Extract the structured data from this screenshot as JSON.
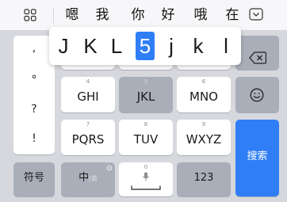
{
  "candidate_bar": {
    "candidates": [
      "嗯",
      "我",
      "你",
      "好",
      "哦",
      "在"
    ]
  },
  "popup": {
    "letters": [
      "J",
      "K",
      "L",
      "5",
      "j",
      "k",
      "l"
    ],
    "selected": "5"
  },
  "left_column": {
    "items": [
      ",",
      "°",
      "?",
      "!"
    ]
  },
  "keys": {
    "ghi": {
      "num": "4",
      "label": "GHI"
    },
    "jkl": {
      "num": "5",
      "label": "JKL"
    },
    "mno": {
      "num": "6",
      "label": "MNO"
    },
    "pqrs": {
      "num": "7",
      "label": "PQRS"
    },
    "tuv": {
      "num": "8",
      "label": "TUV"
    },
    "wxyz": {
      "num": "9",
      "label": "WXYZ"
    },
    "symbols": "符号",
    "chinese": "中",
    "chinese_sub": "/英",
    "space_num": "0",
    "numbers": "123",
    "search": "搜索"
  },
  "colors": {
    "accent": "#2f7ef6",
    "key_bg": "#ffffff",
    "func_key_bg": "#a9aeb9",
    "keyboard_bg": "#d6d8de"
  }
}
